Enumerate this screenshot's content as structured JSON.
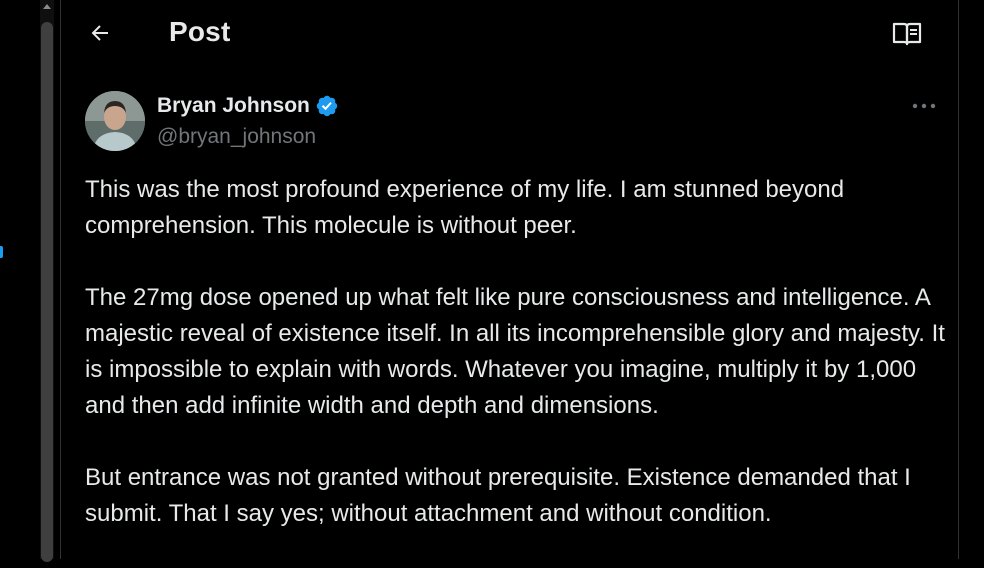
{
  "header": {
    "title": "Post"
  },
  "author": {
    "name": "Bryan Johnson",
    "handle": "@bryan_johnson",
    "verified": true
  },
  "post": {
    "paragraphs": [
      "This was the most profound experience of my life. I am stunned beyond comprehension. This molecule is without peer.",
      "The 27mg dose opened up what felt like pure consciousness and intelligence. A majestic reveal of existence itself. In all its incomprehensible glory and majesty. It is impossible to explain with words. Whatever you imagine, multiply it by 1,000 and then add infinite width and depth and dimensions.",
      "But entrance was not granted without prerequisite. Existence demanded that I submit. That I say yes; without attachment and without condition."
    ]
  },
  "icons": {
    "back": "back-arrow-icon",
    "reader": "reader-mode-icon",
    "verified": "verified-badge-icon",
    "more": "more-options-icon"
  },
  "colors": {
    "background": "#000000",
    "text": "#e7e9ea",
    "secondary_text": "#71767b",
    "accent": "#1d9bf0",
    "border": "#2f3336"
  }
}
